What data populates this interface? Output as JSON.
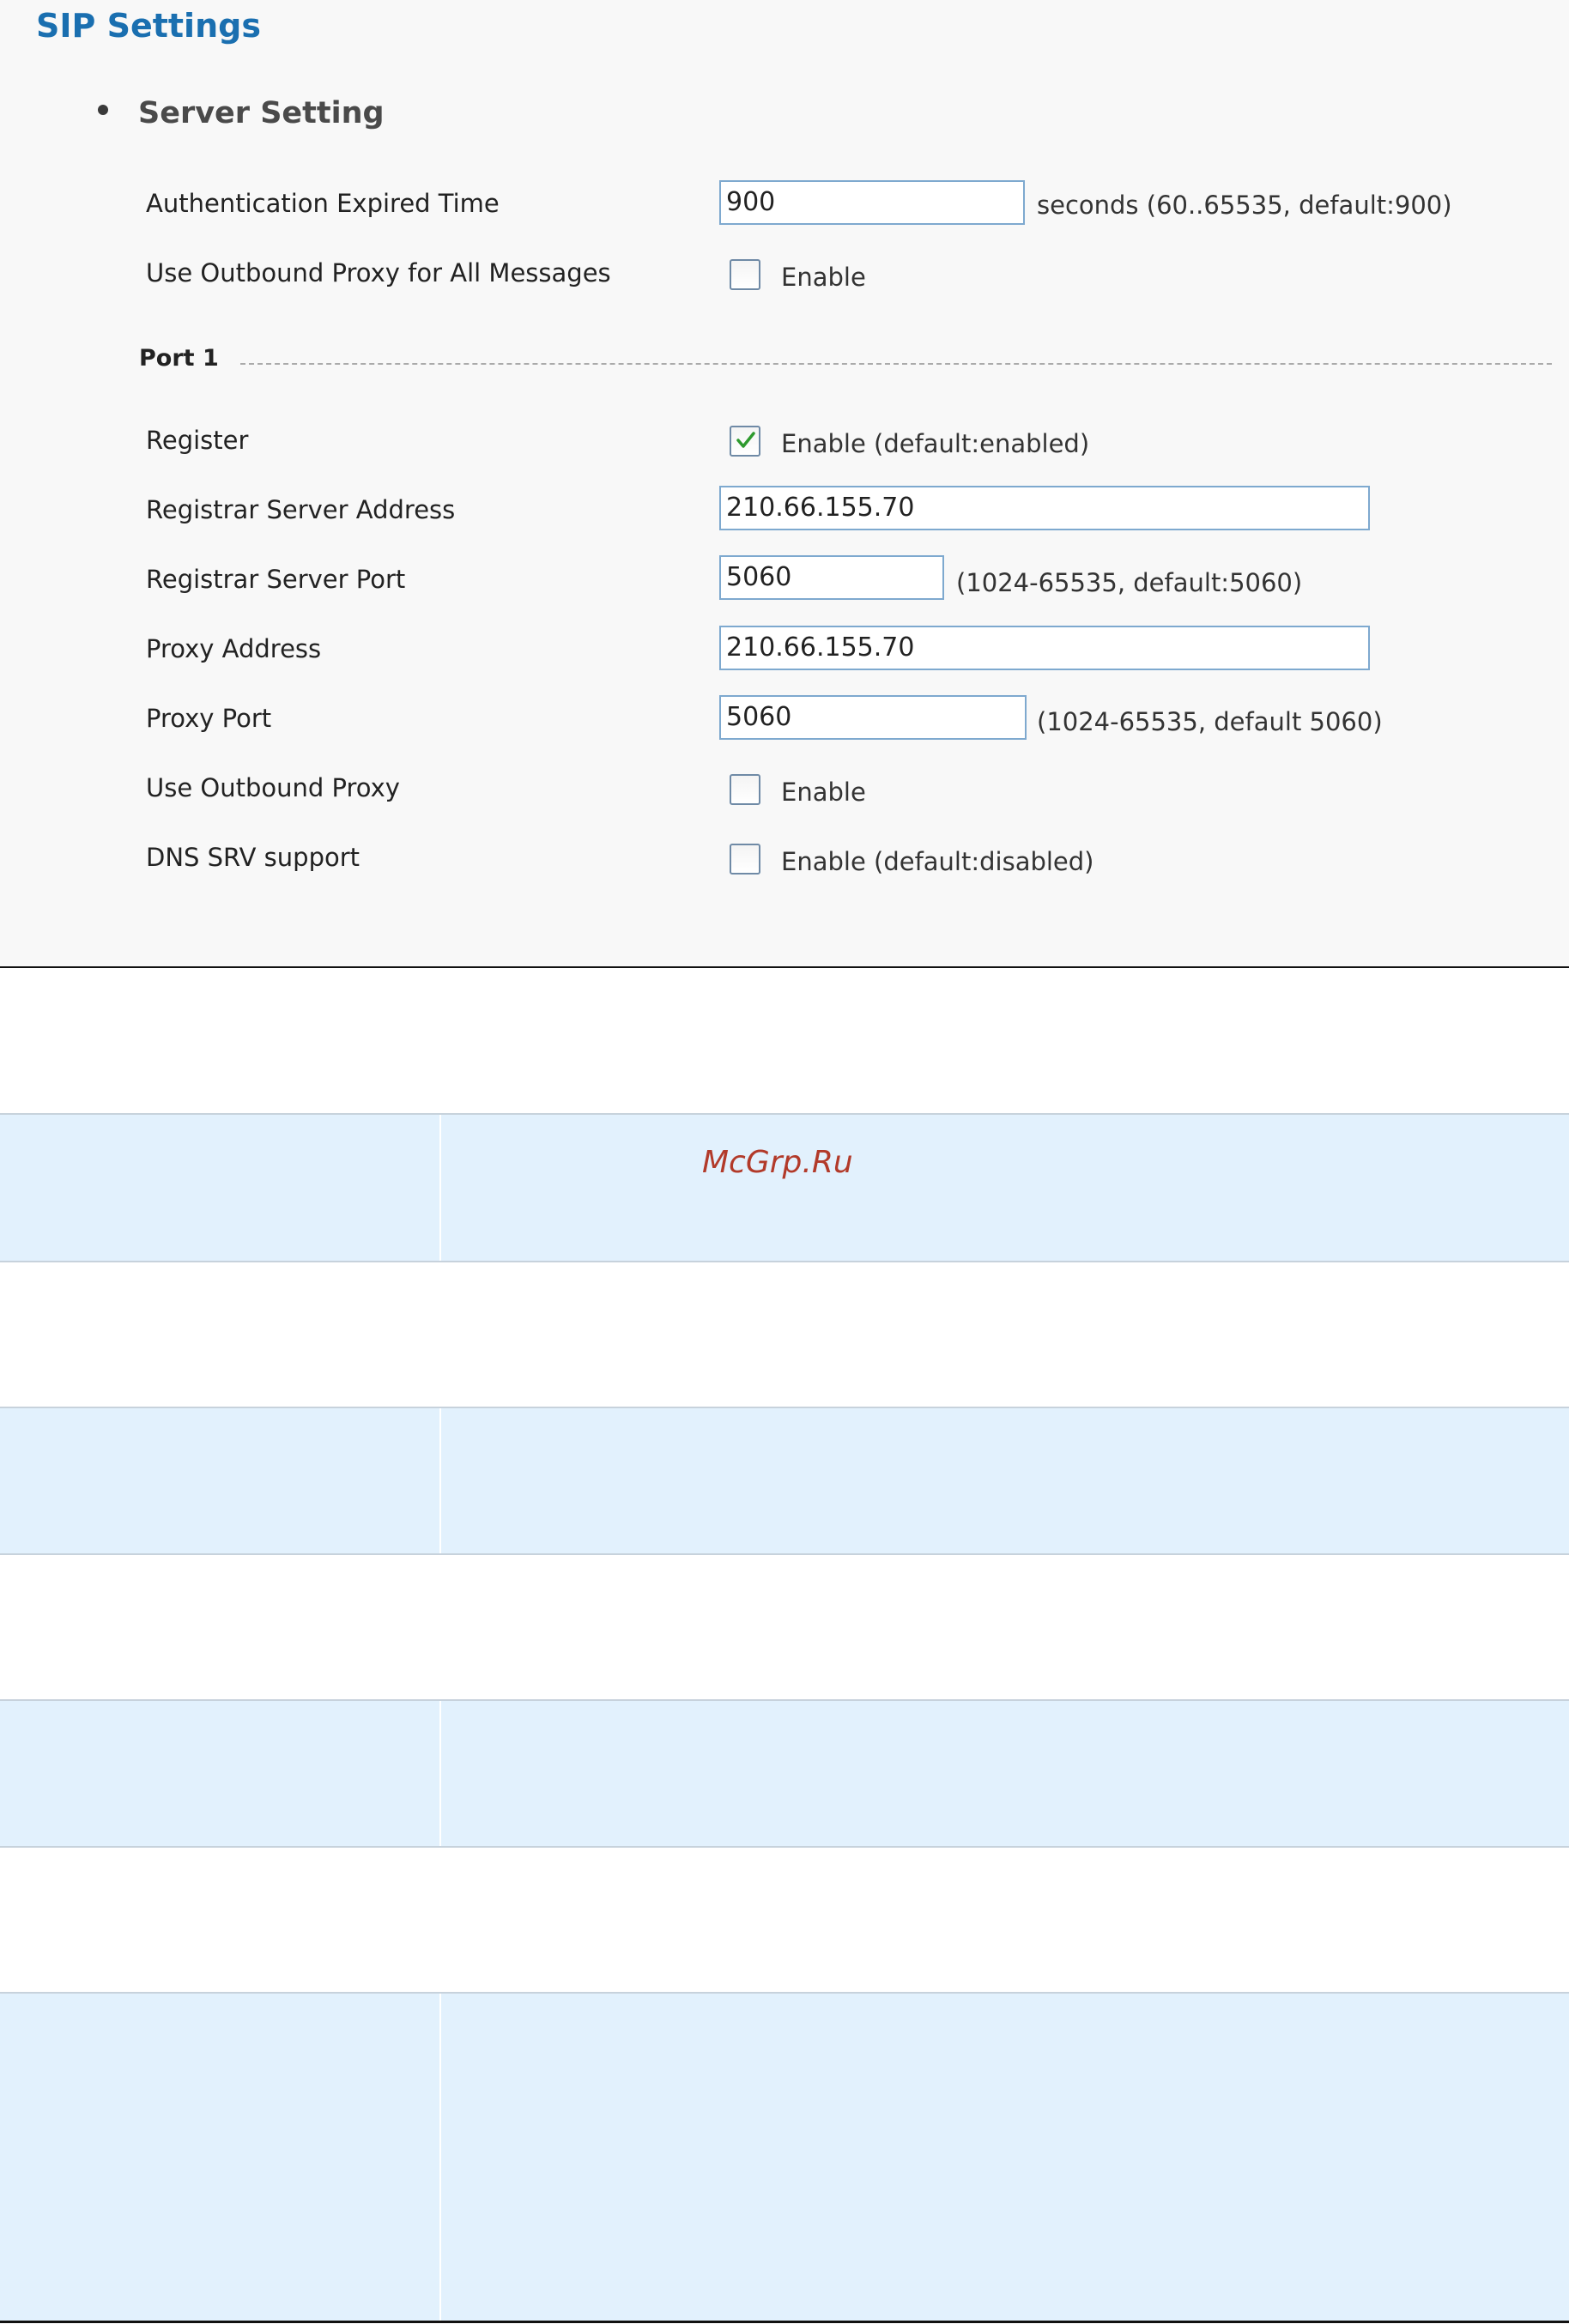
{
  "page": {
    "title": "SIP Settings",
    "section": "Server Setting"
  },
  "global": {
    "auth_expired": {
      "label": "Authentication Expired Time",
      "value": "900",
      "hint": "seconds (60..65535, default:900)"
    },
    "outbound_all": {
      "label": "Use Outbound Proxy for All Messages",
      "checked": false,
      "option": "Enable"
    }
  },
  "port": {
    "label": "Port 1",
    "register": {
      "label": "Register",
      "checked": true,
      "option": "Enable (default:enabled)"
    },
    "registrar_address": {
      "label": "Registrar Server Address",
      "value": "210.66.155.70"
    },
    "registrar_port": {
      "label": "Registrar Server Port",
      "value": "5060",
      "hint": "(1024-65535, default:5060)"
    },
    "proxy_address": {
      "label": "Proxy Address",
      "value": "210.66.155.70"
    },
    "proxy_port": {
      "label": "Proxy Port",
      "value": "5060",
      "hint": "(1024-65535, default 5060)"
    },
    "use_outbound": {
      "label": "Use Outbound Proxy",
      "checked": false,
      "option": "Enable"
    },
    "dns_srv": {
      "label": "DNS SRV support",
      "checked": false,
      "option": "Enable (default:disabled)"
    }
  },
  "watermark": "McGrp.Ru",
  "colors": {
    "title": "#1a6fb0",
    "input_border": "#7ea9cf",
    "check_mark": "#2e9a2e",
    "row_blue": "#e2f1fd",
    "watermark": "#b23a2a"
  }
}
